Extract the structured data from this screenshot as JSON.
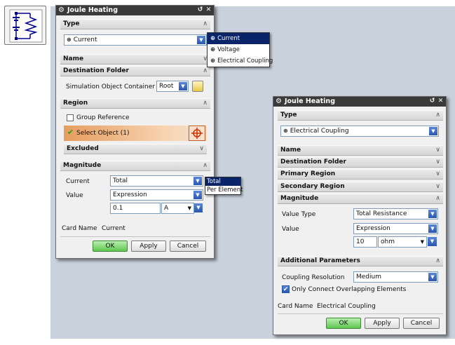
{
  "dialog1": {
    "title": "Joule Heating",
    "type_section": "Type",
    "type_value": "Current",
    "type_options": [
      "Current",
      "Voltage",
      "Electrical Coupling"
    ],
    "name_section": "Name",
    "dest_section": "Destination Folder",
    "container_label": "Simulation Object Container",
    "container_value": "Root",
    "region_section": "Region",
    "group_reference": "Group Reference",
    "select_object": "Select Object (1)",
    "excluded": "Excluded",
    "magnitude_section": "Magnitude",
    "current_label": "Current",
    "current_value": "Total",
    "current_options": [
      "Total",
      "Per Element"
    ],
    "value_label": "Value",
    "value_value": "Expression",
    "number": "0.1",
    "unit": "A",
    "card_name_label": "Card Name",
    "card_name_value": "Current",
    "ok": "OK",
    "apply": "Apply",
    "cancel": "Cancel"
  },
  "dialog2": {
    "title": "Joule Heating",
    "type_section": "Type",
    "type_value": "Electrical Coupling",
    "name_section": "Name",
    "dest_section": "Destination Folder",
    "primary_section": "Primary Region",
    "secondary_section": "Secondary Region",
    "magnitude_section": "Magnitude",
    "value_type_label": "Value Type",
    "value_type_value": "Total Resistance",
    "value_label": "Value",
    "value_value": "Expression",
    "number": "10",
    "unit": "ohm",
    "additional_section": "Additional Parameters",
    "coupling_label": "Coupling Resolution",
    "coupling_value": "Medium",
    "only_connect": "Only Connect Overlapping Elements",
    "only_connect_checked": true,
    "card_name_label": "Card Name",
    "card_name_value": "Electrical Coupling",
    "ok": "OK",
    "apply": "Apply",
    "cancel": "Cancel"
  },
  "colors": {
    "background": "#c8d1dc",
    "title_bar": "#3a3a3a",
    "dropdown_button": "#2a56b0",
    "selection": "#0a246a",
    "ok_button": "#5fc550",
    "select_object_highlight": "#e9a46a"
  },
  "icons": [
    "circuit-icon",
    "gear-icon",
    "reset-icon",
    "close-icon",
    "chevron-up-icon",
    "chevron-down-icon",
    "check-icon",
    "crosshair-icon",
    "folder-icon",
    "dropdown-arrow-icon"
  ]
}
